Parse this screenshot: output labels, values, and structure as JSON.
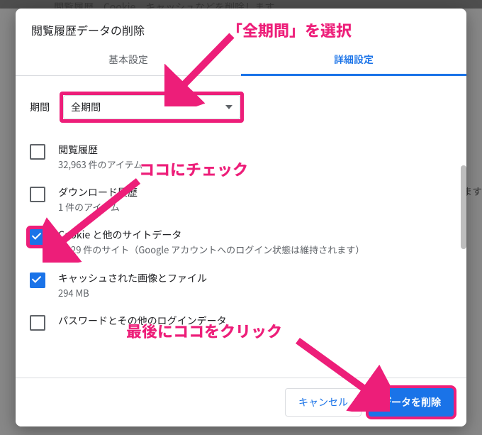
{
  "background": {
    "masked_text": "閲覧履歴、Cookie、キャッシュなどを削除します",
    "side_text": "ます"
  },
  "dialog": {
    "title": "閲覧履歴データの削除",
    "tabs": {
      "basic": "基本設定",
      "advanced": "詳細設定"
    },
    "range_label": "期間",
    "range_value": "全期間",
    "items": [
      {
        "title": "閲覧履歴",
        "sub": "32,963 件のアイテム",
        "checked": false,
        "highlight": false
      },
      {
        "title": "ダウンロード履歴",
        "sub": "1 件のアイテム",
        "checked": false,
        "highlight": false
      },
      {
        "title": "Cookie と他のサイトデータ",
        "sub": "1,329 件のサイト（Google アカウントへのログイン状態は維持されます）",
        "checked": true,
        "highlight": true
      },
      {
        "title": "キャッシュされた画像とファイル",
        "sub": "294 MB",
        "checked": true,
        "highlight": false
      },
      {
        "title": "パスワードとその他のログインデータ",
        "sub": "",
        "checked": false,
        "highlight": false
      }
    ],
    "buttons": {
      "cancel": "キャンセル",
      "confirm": "データを削除"
    }
  },
  "annotations": {
    "select_range": "「全期間」を選択",
    "check_here": "ココにチェック",
    "click_last": "最後にココをクリック"
  }
}
